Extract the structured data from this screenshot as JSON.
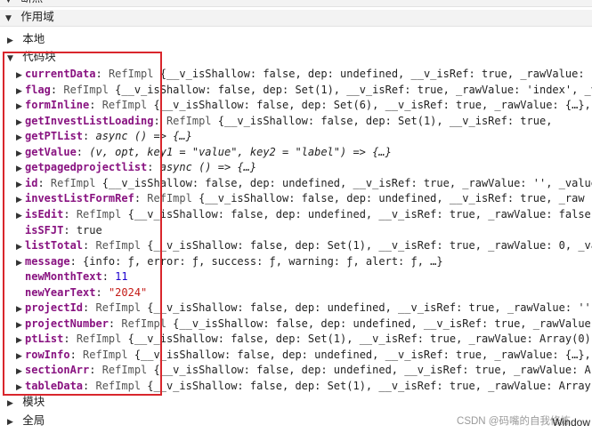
{
  "top_partial_label": "断点",
  "scope_header": "作用域",
  "sections": {
    "local": "本地",
    "code_block": "代码块",
    "module": "模块",
    "global": "全局"
  },
  "global_value": "Window",
  "watermark": "CSDN @码嘴的自我修炼",
  "colors": {
    "highlight_border": "#d9262c",
    "prop_name": "#881280",
    "string": "#c41a16",
    "number": "#1c00cf"
  },
  "props": [
    {
      "name": "currentData",
      "expandable": true,
      "type": "RefImpl",
      "value": "{__v_isShallow: false, dep: undefined, __v_isRef: true, _rawValue: "
    },
    {
      "name": "flag",
      "expandable": true,
      "type": "RefImpl",
      "value": "{__v_isShallow: false, dep: Set(1), __v_isRef: true, _rawValue: 'index', _v"
    },
    {
      "name": "formInline",
      "expandable": true,
      "type": "RefImpl",
      "value": "{__v_isShallow: false, dep: Set(6), __v_isRef: true, _rawValue: {…}, "
    },
    {
      "name": "getInvestListLoading",
      "expandable": true,
      "type": "RefImpl",
      "value": "{__v_isShallow: false, dep: Set(1), __v_isRef: true,"
    },
    {
      "name": "getPTList",
      "expandable": true,
      "type": "",
      "value": "async () => {…}",
      "kind": "fn"
    },
    {
      "name": "getValue",
      "expandable": true,
      "type": "",
      "value": "(v, opt, key1 = \"value\", key2 = \"label\") => {…}",
      "kind": "fn"
    },
    {
      "name": "getpagedprojectlist",
      "expandable": true,
      "type": "",
      "value": "async () => {…}",
      "kind": "fn"
    },
    {
      "name": "id",
      "expandable": true,
      "type": "RefImpl",
      "value": "{__v_isShallow: false, dep: undefined, __v_isRef: true, _rawValue: '', _value:"
    },
    {
      "name": "investListFormRef",
      "expandable": true,
      "type": "RefImpl",
      "value": "{__v_isShallow: false, dep: undefined, __v_isRef: true, _raw"
    },
    {
      "name": "isEdit",
      "expandable": true,
      "type": "RefImpl",
      "value": "{__v_isShallow: false, dep: undefined, __v_isRef: true, _rawValue: false,"
    },
    {
      "name": "isSFJT",
      "expandable": false,
      "type": "",
      "value": "true",
      "kind": "plain"
    },
    {
      "name": "listTotal",
      "expandable": true,
      "type": "RefImpl",
      "value": "{__v_isShallow: false, dep: Set(1), __v_isRef: true, _rawValue: 0, _va"
    },
    {
      "name": "message",
      "expandable": true,
      "type": "",
      "value": "{info: ƒ, error: ƒ, success: ƒ, warning: ƒ, alert: ƒ, …}",
      "kind": "plain"
    },
    {
      "name": "newMonthText",
      "expandable": false,
      "type": "",
      "value": "11",
      "kind": "num"
    },
    {
      "name": "newYearText",
      "expandable": false,
      "type": "",
      "value": "\"2024\"",
      "kind": "str"
    },
    {
      "name": "projectId",
      "expandable": true,
      "type": "RefImpl",
      "value": "{__v_isShallow: false, dep: undefined, __v_isRef: true, _rawValue: '',"
    },
    {
      "name": "projectNumber",
      "expandable": true,
      "type": "RefImpl",
      "value": "{__v_isShallow: false, dep: undefined, __v_isRef: true, _rawValue:"
    },
    {
      "name": "ptList",
      "expandable": true,
      "type": "RefImpl",
      "value": "{__v_isShallow: false, dep: Set(1), __v_isRef: true, _rawValue: Array(0),"
    },
    {
      "name": "rowInfo",
      "expandable": true,
      "type": "RefImpl",
      "value": "{__v_isShallow: false, dep: undefined, __v_isRef: true, _rawValue: {…},"
    },
    {
      "name": "sectionArr",
      "expandable": true,
      "type": "RefImpl",
      "value": "{__v_isShallow: false, dep: undefined, __v_isRef: true, _rawValue: Ar"
    },
    {
      "name": "tableData",
      "expandable": true,
      "type": "RefImpl",
      "value": "{__v_isShallow: false, dep: Set(1), __v_isRef: true, _rawValue: Array"
    }
  ]
}
